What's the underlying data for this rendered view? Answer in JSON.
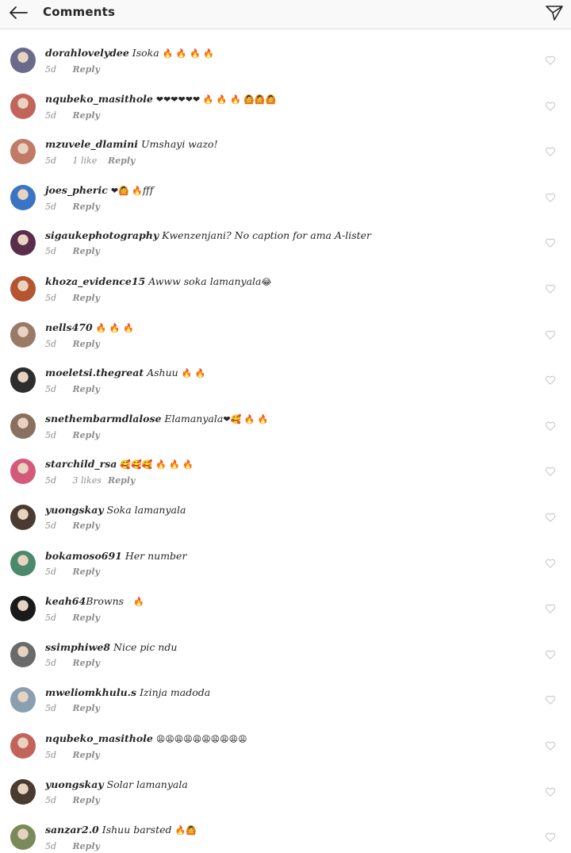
{
  "header": {
    "title": "Comments"
  },
  "reply_label": "Reply",
  "comments": [
    {
      "username": "dorahlovelydee",
      "text": "Isoka",
      "emoji": "🔥 🔥 🔥 🔥",
      "time": "5d",
      "likes": "",
      "avatar_color": "#6a6a8a"
    },
    {
      "username": "nqubeko_masithole",
      "text": "",
      "emoji": "❤❤❤❤❤❤ 🔥 🔥 🔥 🙆🙆🙆",
      "time": "5d",
      "likes": "",
      "avatar_color": "#c2645a"
    },
    {
      "username": "mzuvele_dlamini",
      "text": "Umshayi wazo!",
      "emoji": "",
      "time": "5d",
      "likes": "1 like",
      "avatar_color": "#c07a66"
    },
    {
      "username": "joes_pheric",
      "text": "fff",
      "emoji": "❤🙆 🔥",
      "time": "5d",
      "likes": "",
      "avatar_color": "#3b74c4"
    },
    {
      "username": "sigaukephotography",
      "text": "Kwenzenjani? No caption for ama A-lister",
      "emoji": "",
      "time": "5d",
      "likes": "",
      "avatar_color": "#5a2d4a"
    },
    {
      "username": "khoza_evidence15",
      "text": "Awww soka lamanyala",
      "emoji": "😂",
      "time": "5d",
      "likes": "",
      "avatar_color": "#b5552f"
    },
    {
      "username": "nells470",
      "text": "",
      "emoji": "🔥 🔥 🔥",
      "time": "5d",
      "likes": "",
      "avatar_color": "#9a7a66"
    },
    {
      "username": "moeletsi.thegreat",
      "text": "Ashuu",
      "emoji": "🔥 🔥",
      "time": "5d",
      "likes": "",
      "avatar_color": "#2e2e2e"
    },
    {
      "username": "snethembarmdlalose",
      "text": "Elamanyala",
      "emoji": "❤🥰 🔥 🔥",
      "time": "5d",
      "likes": "",
      "avatar_color": "#8a7060"
    },
    {
      "username": "starchild_rsa",
      "text": "",
      "emoji": "🥰🥰🥰 🔥 🔥 🔥",
      "time": "5d",
      "likes": "3 likes",
      "avatar_color": "#d45a7a"
    },
    {
      "username": "yuongskay",
      "text": "Soka lamanyala",
      "emoji": "",
      "time": "5d",
      "likes": "",
      "avatar_color": "#4a3a30"
    },
    {
      "username": "bokamoso691",
      "text": "Her number",
      "emoji": "",
      "time": "5d",
      "likes": "",
      "avatar_color": "#4a8a6a"
    },
    {
      "username": "keah64",
      "text": "Browns",
      "emoji": "🔥",
      "time": "5d",
      "likes": "",
      "avatar_color": "#1a1a1a"
    },
    {
      "username": "ssimphiwe8",
      "text": "Nice pic ndu",
      "emoji": "",
      "time": "5d",
      "likes": "",
      "avatar_color": "#6a6a6a"
    },
    {
      "username": "mweliomkhulu.s",
      "text": "Izinja madoda",
      "emoji": "",
      "time": "5d",
      "likes": "",
      "avatar_color": "#8aa0b0"
    },
    {
      "username": "nqubeko_masithole",
      "text": "",
      "emoji": "😩😩😩😩😩😩😩😩😩😩",
      "time": "5d",
      "likes": "",
      "avatar_color": "#c2645a"
    },
    {
      "username": "yuongskay",
      "text": "Solar lamanyala",
      "emoji": "",
      "time": "5d",
      "likes": "",
      "avatar_color": "#4a3a30"
    },
    {
      "username": "sanzar2.0",
      "text": "Ishuu  barsted",
      "emoji": "🔥🙆",
      "time": "5d",
      "likes": "",
      "avatar_color": "#7a8a5a"
    }
  ]
}
